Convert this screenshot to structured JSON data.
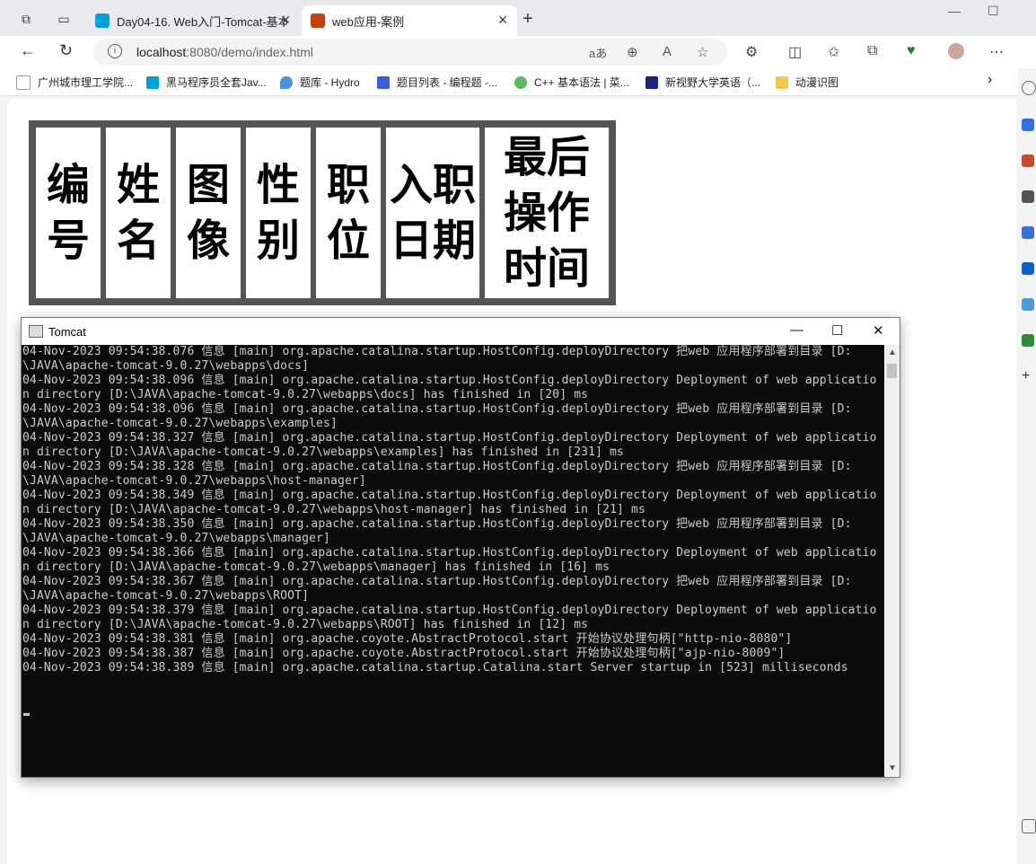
{
  "browser": {
    "tabs": [
      {
        "title": "Day04-16. Web入门-Tomcat-基本",
        "favicon_color": "#00a1d6"
      },
      {
        "title": "web应用-案例",
        "favicon_color": "#c2410c"
      }
    ],
    "url_host": "localhost",
    "url_rest": ":8080/demo/index.html",
    "read_aloud_label": "aあ"
  },
  "favorites": [
    {
      "label": "广州城市理工学院...",
      "color": "#ffffff"
    },
    {
      "label": "黑马程序员全套Jav...",
      "color": "#00a1d6"
    },
    {
      "label": "题库 - Hydro",
      "color": "#4a90e2"
    },
    {
      "label": "题目列表 - 编程题 -...",
      "color": "#3b5bdb"
    },
    {
      "label": "C++ 基本语法 | 菜...",
      "color": "#5cb85c"
    },
    {
      "label": "新视野大学英语（...",
      "color": "#1a237e"
    },
    {
      "label": "动漫识图",
      "color": "#f2c94c"
    }
  ],
  "table_headers": [
    [
      "编",
      "号"
    ],
    [
      "姓",
      "名"
    ],
    [
      "图",
      "像"
    ],
    [
      "性",
      "别"
    ],
    [
      "职",
      "位"
    ],
    [
      "入职",
      "日期"
    ],
    [
      "最后",
      "操作",
      "时间"
    ]
  ],
  "tomcat": {
    "title": "Tomcat",
    "lines": [
      "04-Nov-2023 09:54:38.076 信息 [main] org.apache.catalina.startup.HostConfig.deployDirectory 把web 应用程序部署到目录 [D:",
      "\\JAVA\\apache-tomcat-9.0.27\\webapps\\docs]",
      "04-Nov-2023 09:54:38.096 信息 [main] org.apache.catalina.startup.HostConfig.deployDirectory Deployment of web applicatio",
      "n directory [D:\\JAVA\\apache-tomcat-9.0.27\\webapps\\docs] has finished in [20] ms",
      "04-Nov-2023 09:54:38.096 信息 [main] org.apache.catalina.startup.HostConfig.deployDirectory 把web 应用程序部署到目录 [D:",
      "\\JAVA\\apache-tomcat-9.0.27\\webapps\\examples]",
      "04-Nov-2023 09:54:38.327 信息 [main] org.apache.catalina.startup.HostConfig.deployDirectory Deployment of web applicatio",
      "n directory [D:\\JAVA\\apache-tomcat-9.0.27\\webapps\\examples] has finished in [231] ms",
      "04-Nov-2023 09:54:38.328 信息 [main] org.apache.catalina.startup.HostConfig.deployDirectory 把web 应用程序部署到目录 [D:",
      "\\JAVA\\apache-tomcat-9.0.27\\webapps\\host-manager]",
      "04-Nov-2023 09:54:38.349 信息 [main] org.apache.catalina.startup.HostConfig.deployDirectory Deployment of web applicatio",
      "n directory [D:\\JAVA\\apache-tomcat-9.0.27\\webapps\\host-manager] has finished in [21] ms",
      "04-Nov-2023 09:54:38.350 信息 [main] org.apache.catalina.startup.HostConfig.deployDirectory 把web 应用程序部署到目录 [D:",
      "\\JAVA\\apache-tomcat-9.0.27\\webapps\\manager]",
      "04-Nov-2023 09:54:38.366 信息 [main] org.apache.catalina.startup.HostConfig.deployDirectory Deployment of web applicatio",
      "n directory [D:\\JAVA\\apache-tomcat-9.0.27\\webapps\\manager] has finished in [16] ms",
      "04-Nov-2023 09:54:38.367 信息 [main] org.apache.catalina.startup.HostConfig.deployDirectory 把web 应用程序部署到目录 [D:",
      "\\JAVA\\apache-tomcat-9.0.27\\webapps\\ROOT]",
      "04-Nov-2023 09:54:38.379 信息 [main] org.apache.catalina.startup.HostConfig.deployDirectory Deployment of web applicatio",
      "n directory [D:\\JAVA\\apache-tomcat-9.0.27\\webapps\\ROOT] has finished in [12] ms",
      "04-Nov-2023 09:54:38.381 信息 [main] org.apache.coyote.AbstractProtocol.start 开始协议处理句柄[\"http-nio-8080\"]",
      "04-Nov-2023 09:54:38.387 信息 [main] org.apache.coyote.AbstractProtocol.start 开始协议处理句柄[\"ajp-nio-8009\"]",
      "04-Nov-2023 09:54:38.389 信息 [main] org.apache.catalina.startup.Catalina.start Server startup in [523] milliseconds"
    ]
  }
}
